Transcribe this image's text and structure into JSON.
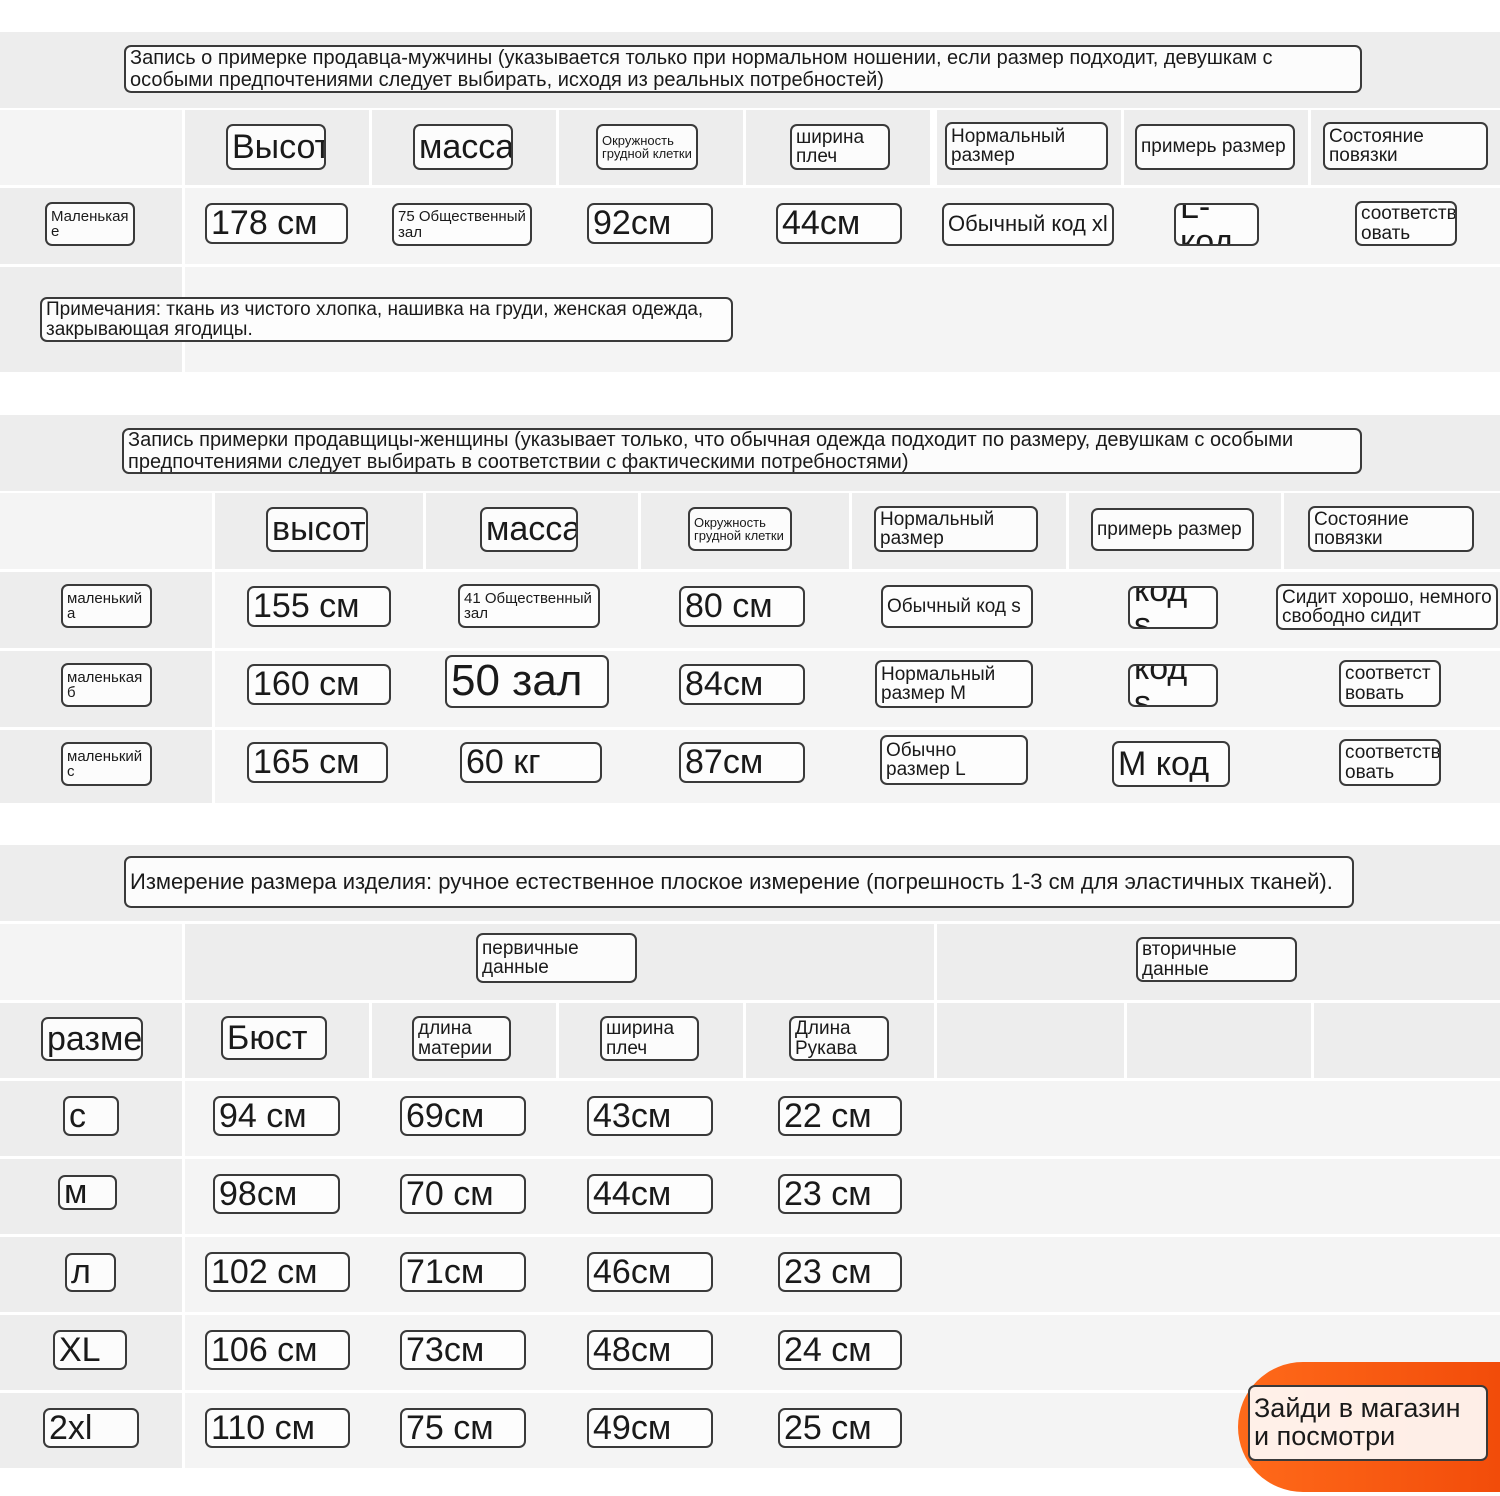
{
  "male_section": {
    "title": "Запись о примерке продавца-мужчины (указывается только при нормальном ношении, если размер подходит, девушкам с особыми предпочтениями следует выбирать, исходя из реальных потребностей)",
    "headers": [
      "Высота",
      "масса",
      "Окружность грудной клетки",
      "ширина плеч",
      "Нормальный размер",
      "примерь размер",
      "Состояние повязки"
    ],
    "row": {
      "label": "Маленькая е",
      "values": [
        "178 см",
        "75 Общественный зал",
        "92см",
        "44см",
        "Обычный код xl",
        "L-код",
        "соответств овать"
      ]
    },
    "note": "Примечания: ткань из чистого хлопка, нашивка на груди, женская одежда, закрывающая ягодицы."
  },
  "female_section": {
    "title": "Запись примерки продавщицы-женщины (указывает только, что обычная одежда подходит по размеру, девушкам с особыми предпочтениями следует выбирать в соответствии с фактическими потребностями)",
    "headers": [
      "высота",
      "масса",
      "Окружность грудной клетки",
      "Нормальный размер",
      "примерь размер",
      "Состояние повязки"
    ],
    "rows": [
      {
        "label": "маленький а",
        "values": [
          "155 см",
          "41 Общественный зал",
          "80 см",
          "Обычный код s",
          "код s",
          "Сидит хорошо, немного свободно сидит"
        ]
      },
      {
        "label": "маленькая б",
        "values": [
          "160 см",
          "50 зал",
          "84см",
          "Нормальный размер M",
          "код s",
          "соответст вовать"
        ]
      },
      {
        "label": "маленький с",
        "values": [
          "165 см",
          "60 кг",
          "87см",
          "Обычно размер L",
          "М код",
          "соответств овать"
        ]
      }
    ]
  },
  "product_section": {
    "title": "Измерение размера изделия: ручное естественное плоское измерение (погрешность 1-3 см для эластичных тканей).",
    "group_primary": "первичные данные",
    "group_secondary": "вторичные данные",
    "headers": [
      "размер",
      "Бюст",
      "длина материи",
      "ширина плеч",
      "Длина Рукава"
    ],
    "rows": [
      {
        "size": "с",
        "values": [
          "94 см",
          "69см",
          "43см",
          "22 см"
        ]
      },
      {
        "size": "м",
        "values": [
          "98см",
          "70 см",
          "44см",
          "23 см"
        ]
      },
      {
        "size": "л",
        "values": [
          "102 см",
          "71см",
          "46см",
          "23 см"
        ]
      },
      {
        "size": "XL",
        "values": [
          "106 см",
          "73см",
          "48см",
          "24 см"
        ]
      },
      {
        "size": "2xl",
        "values": [
          "110 см",
          "75 см",
          "49см",
          "25 см"
        ]
      }
    ]
  },
  "cta": {
    "label": "Зайди в магазин и посмотри",
    "color": "#f55a12"
  }
}
